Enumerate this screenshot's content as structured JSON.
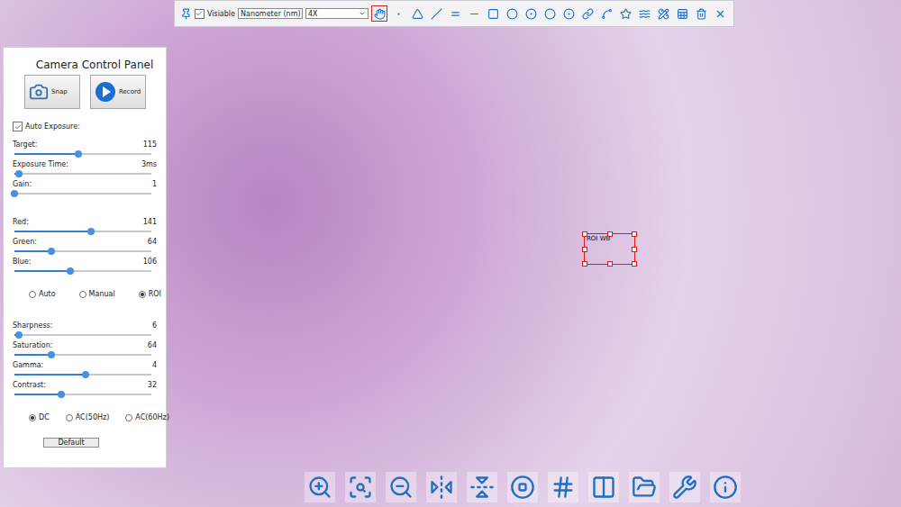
{
  "top_toolbar": {
    "visible_checkbox": {
      "label": "Visiable",
      "checked": true
    },
    "unit_select": "Nanometer (nm)",
    "magnification_select": "4X",
    "tools": [
      {
        "selected": true
      },
      {
        "selected": false
      },
      {
        "selected": false
      },
      {
        "selected": false
      },
      {
        "selected": false
      },
      {
        "selected": false
      },
      {
        "selected": false
      },
      {
        "selected": false
      },
      {
        "selected": false
      },
      {
        "selected": false
      },
      {
        "selected": false
      },
      {
        "selected": false
      },
      {
        "selected": false
      },
      {
        "selected": false
      },
      {
        "selected": false
      },
      {
        "selected": false
      },
      {
        "selected": false
      },
      {
        "selected": false
      },
      {
        "selected": false
      }
    ]
  },
  "control_panel": {
    "title": "Camera Control Panel",
    "buttons": [
      {
        "label": "Snap"
      },
      {
        "label": "Record"
      }
    ],
    "auto_exposure": {
      "label": "Auto Exposure:",
      "checked": true
    },
    "exposure_sliders": [
      {
        "label": "Target:",
        "reading": "115",
        "level": 0.47
      },
      {
        "label": "Exposure Time:",
        "reading": "3ms",
        "level": 0.03
      },
      {
        "label": "Gain:",
        "reading": "1",
        "level": 0.0
      }
    ],
    "white_balance_sliders": [
      {
        "label": "Red:",
        "reading": "141",
        "level": 0.56
      },
      {
        "label": "Green:",
        "reading": "64",
        "level": 0.27
      },
      {
        "label": "Blue:",
        "reading": "106",
        "level": 0.41
      }
    ],
    "white_balance_modes": [
      {
        "label": "Auto",
        "selected": false
      },
      {
        "label": "Manual",
        "selected": false
      },
      {
        "label": "ROI",
        "selected": true
      }
    ],
    "image_sliders": [
      {
        "label": "Sharpness:",
        "reading": "6",
        "level": 0.03
      },
      {
        "label": "Saturation:",
        "reading": "64",
        "level": 0.27
      },
      {
        "label": "Gamma:",
        "reading": "4",
        "level": 0.52
      },
      {
        "label": "Contrast:",
        "reading": "32",
        "level": 0.34
      }
    ],
    "power_frequency": [
      {
        "label": "DC",
        "selected": true
      },
      {
        "label": "AC(50Hz)",
        "selected": false
      },
      {
        "label": "AC(60Hz)",
        "selected": false
      }
    ],
    "default_button": "Default"
  },
  "roi": {
    "label": "ROI WB"
  }
}
